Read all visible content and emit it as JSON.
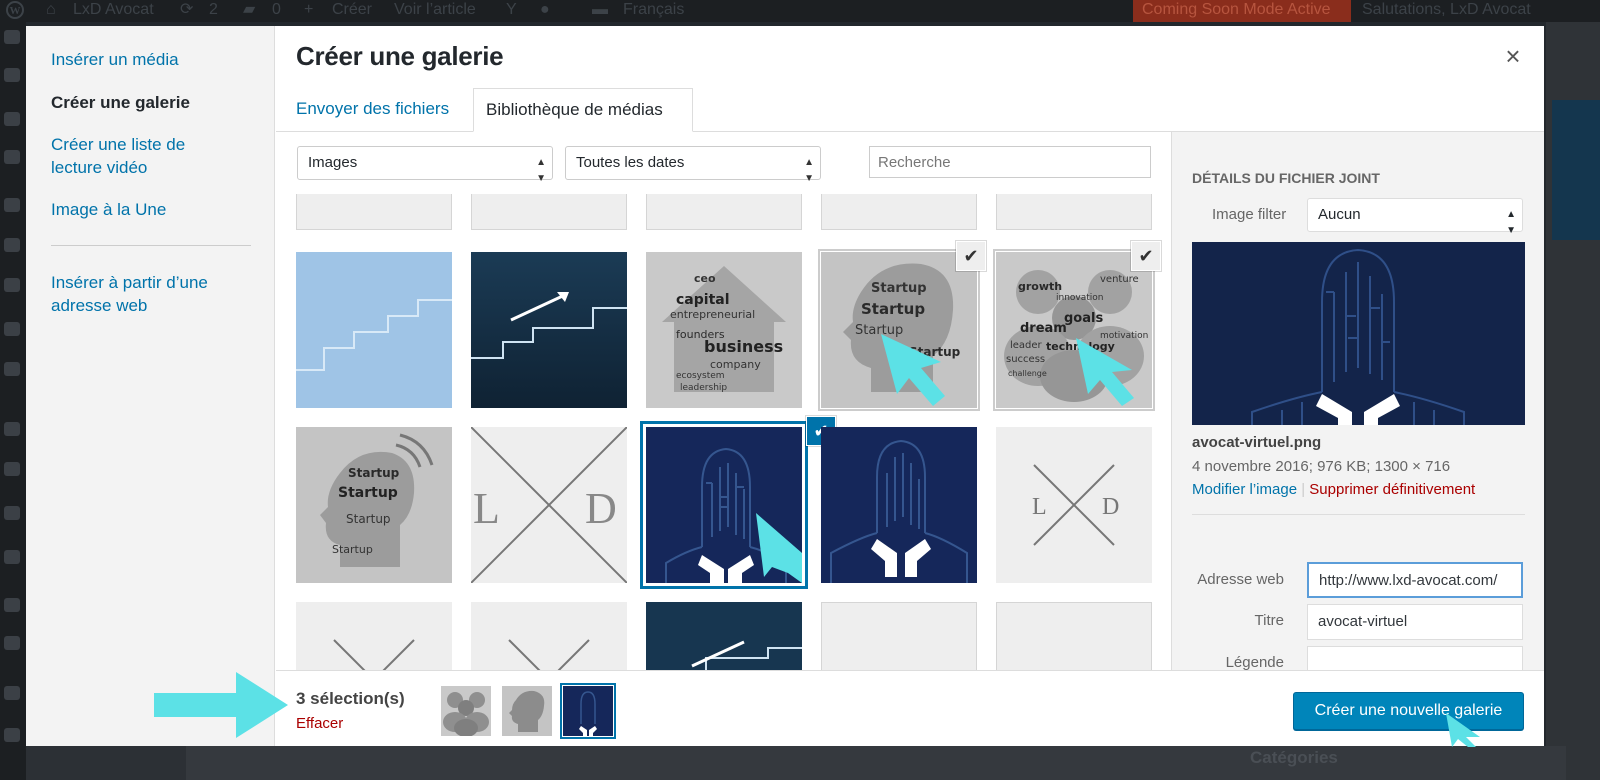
{
  "colors": {
    "accent": "#0073aa",
    "primary_button": "#0085ba",
    "danger": "#aa0000",
    "annotation_arrow": "#5ce1e6",
    "admin_bar": "#1c1f22"
  },
  "adminbar": {
    "site_name": "LxD Avocat",
    "updates_count": "2",
    "comments_count": "0",
    "new_label": "Créer",
    "view_post": "Voir l’article",
    "language": "Français",
    "coming_soon": "Coming Soon Mode Active",
    "greeting": "Salutations, LxD Avocat",
    "icons": [
      "wordpress-logo",
      "home-icon",
      "refresh-icon",
      "comment-icon",
      "plus-icon",
      "yoast-icon",
      "circle-icon",
      "flag-icon"
    ]
  },
  "menu": {
    "items": [
      {
        "label": "Insérer un média"
      },
      {
        "label": "Créer une galerie",
        "active": true
      },
      {
        "label": "Créer une liste de lecture vidéo"
      },
      {
        "label": "Image à la Une"
      },
      {
        "label": "Insérer à partir d’une adresse web"
      }
    ]
  },
  "modal": {
    "title": "Créer une galerie",
    "close_icon": "×",
    "tabs": [
      {
        "label": "Envoyer des fichiers"
      },
      {
        "label": "Bibliothèque de médias",
        "active": true
      }
    ]
  },
  "filters": {
    "type_selected": "Images",
    "date_selected": "Toutes les dates",
    "search_placeholder": "Recherche"
  },
  "grid": {
    "tiles": [
      {
        "name": "stairs-light",
        "selected": false
      },
      {
        "name": "stairs-dark-arrow",
        "selected": false
      },
      {
        "name": "house-word-cloud",
        "selected": false,
        "words": [
          "ceo",
          "capital",
          "entrepreneurial",
          "founders",
          "business",
          "company",
          "ecosystem",
          "leadership"
        ]
      },
      {
        "name": "head-startup-cloud",
        "selected": true,
        "words": [
          "Startup",
          "Startup",
          "Startup",
          "Startup"
        ]
      },
      {
        "name": "people-word-cloud",
        "selected": true,
        "words": [
          "growth",
          "innovation",
          "venture",
          "dream",
          "goals",
          "leader",
          "motivation",
          "success",
          "technology",
          "challenge"
        ]
      },
      {
        "name": "head-wifi-startup",
        "selected": false,
        "words": [
          "Startup",
          "Startup",
          "Startup",
          "Startup"
        ]
      },
      {
        "name": "lxd-logo-large",
        "selected": false,
        "letters": [
          "L",
          "D"
        ]
      },
      {
        "name": "avocat-virtuel",
        "selected": true,
        "focused": true
      },
      {
        "name": "avocat-virtuel-variant",
        "selected": false
      },
      {
        "name": "lxd-logo-small",
        "selected": false,
        "letters": [
          "L",
          "D"
        ]
      }
    ]
  },
  "details": {
    "heading": "Détails du fichier joint",
    "image_filter_label": "Image filter",
    "image_filter_value": "Aucun",
    "filename": "avocat-virtuel.png",
    "meta": "4 novembre 2016;  976 KB;  1300 × 716",
    "edit_link": "Modifier l’image",
    "link_separator": "|",
    "delete_link": "Supprimer définitivement",
    "url_label": "Adresse web",
    "url_value": "http://www.lxd-avocat.com/",
    "title_label": "Titre",
    "title_value": "avocat-virtuel",
    "caption_label": "Légende",
    "caption_value": ""
  },
  "toolbar": {
    "selection_count": "3 sélection(s)",
    "clear_label": "Effacer",
    "create_button": "Créer une nouvelle galerie"
  },
  "background": {
    "categories_label": "Catégories"
  }
}
